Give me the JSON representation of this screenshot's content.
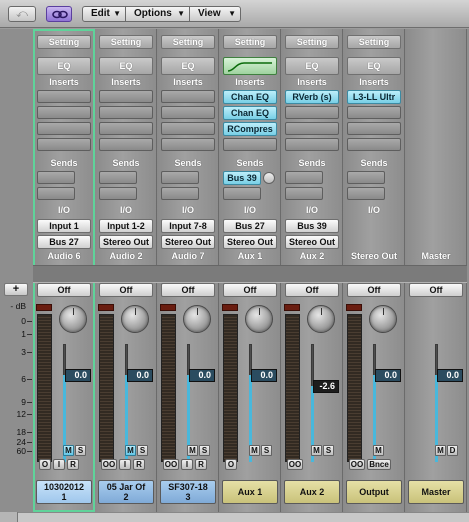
{
  "toolbar": {
    "back_glyph": "⤺",
    "menus": [
      {
        "label": "Edit"
      },
      {
        "label": "Options"
      },
      {
        "label": "View"
      }
    ]
  },
  "labels": {
    "db_header": "- dB",
    "plus": "+",
    "db_scale": [
      "0",
      "1",
      "3",
      "6",
      "9",
      "12",
      "18",
      "24",
      "60"
    ]
  },
  "sections": {
    "setting": "Setting",
    "eq": "EQ",
    "inserts": "Inserts",
    "sends": "Sends",
    "io": "I/O",
    "off": "Off"
  },
  "colors": {
    "selected_outline": "#5fd39a",
    "plugin": "#78cfe6",
    "track_plate": "#7faad7",
    "aux_plate": "#c9c27a"
  },
  "strips": [
    {
      "id": "audio6",
      "name": "Audio 6",
      "selected": true,
      "inserts": [],
      "sends": [],
      "input": "Input 1",
      "output": "Bus 27",
      "volume": "0.0",
      "eq_curve": false,
      "mute_on": true,
      "buttons": [
        "M",
        "S"
      ],
      "bottom_buttons": [
        "O",
        "I",
        "R"
      ],
      "plate": [
        "10302012",
        "1"
      ],
      "plate_color": "blue",
      "has_meter": true,
      "has_knob": true,
      "fader_level": 0.74
    },
    {
      "id": "audio2",
      "name": "Audio 2",
      "selected": false,
      "inserts": [],
      "sends": [],
      "input": "Input 1-2",
      "output": "Stereo Out",
      "volume": "0.0",
      "eq_curve": false,
      "mute_on": true,
      "buttons": [
        "M",
        "S"
      ],
      "bottom_buttons": [
        "OO",
        "I",
        "R"
      ],
      "plate": [
        "05 Jar Of",
        "2"
      ],
      "plate_color": "blue",
      "has_meter": true,
      "has_knob": true,
      "fader_level": 0.74
    },
    {
      "id": "audio7",
      "name": "Audio 7",
      "selected": false,
      "inserts": [],
      "sends": [],
      "input": "Input 7-8",
      "output": "Stereo Out",
      "volume": "0.0",
      "eq_curve": false,
      "mute_on": false,
      "buttons": [
        "M",
        "S"
      ],
      "bottom_buttons": [
        "OO",
        "I",
        "R"
      ],
      "plate": [
        "SF307-18",
        "3"
      ],
      "plate_color": "blue",
      "has_meter": true,
      "has_knob": true,
      "fader_level": 0.74
    },
    {
      "id": "aux1",
      "name": "Aux 1",
      "selected": false,
      "inserts": [
        "Chan EQ",
        "Chan EQ",
        "RCompres"
      ],
      "sends": [
        "Bus 39"
      ],
      "input": "Bus 27",
      "output": "Stereo Out",
      "volume": "0.0",
      "eq_curve": true,
      "mute_on": false,
      "buttons": [
        "M",
        "S"
      ],
      "bottom_buttons": [
        "O"
      ],
      "plate": [
        "Aux 1"
      ],
      "plate_color": "tan",
      "has_meter": true,
      "has_knob": true,
      "fader_level": 0.74
    },
    {
      "id": "aux2",
      "name": "Aux 2",
      "selected": false,
      "inserts": [
        "RVerb (s)"
      ],
      "sends": [],
      "input": "Bus 39",
      "output": "Stereo Out",
      "volume": "-2.6",
      "eq_curve": false,
      "mute_on": false,
      "buttons": [
        "M",
        "S"
      ],
      "bottom_buttons": [
        "OO"
      ],
      "plate": [
        "Aux 2"
      ],
      "plate_color": "tan",
      "has_meter": true,
      "has_knob": true,
      "fader_level": 0.64
    },
    {
      "id": "output",
      "name": "Stereo Out",
      "selected": false,
      "inserts": [
        "L3-LL Ultr"
      ],
      "sends": [],
      "input": "",
      "output": "",
      "volume": "0.0",
      "eq_curve": false,
      "mute_on": false,
      "buttons": [
        "M"
      ],
      "bottom_buttons": [
        "OO",
        "Bnce"
      ],
      "plate": [
        "Output"
      ],
      "plate_color": "tan",
      "has_meter": true,
      "has_knob": true,
      "fader_level": 0.74
    },
    {
      "id": "master",
      "name": "Master",
      "selected": false,
      "inserts": [],
      "sends": [],
      "input": "",
      "output": "",
      "volume": "0.0",
      "eq_curve": false,
      "mute_on": false,
      "buttons": [
        "M",
        "D"
      ],
      "bottom_buttons": [],
      "plate": [
        "Master"
      ],
      "plate_color": "tan",
      "has_meter": false,
      "has_knob": false,
      "fader_level": 0.74,
      "no_setting": true
    }
  ]
}
